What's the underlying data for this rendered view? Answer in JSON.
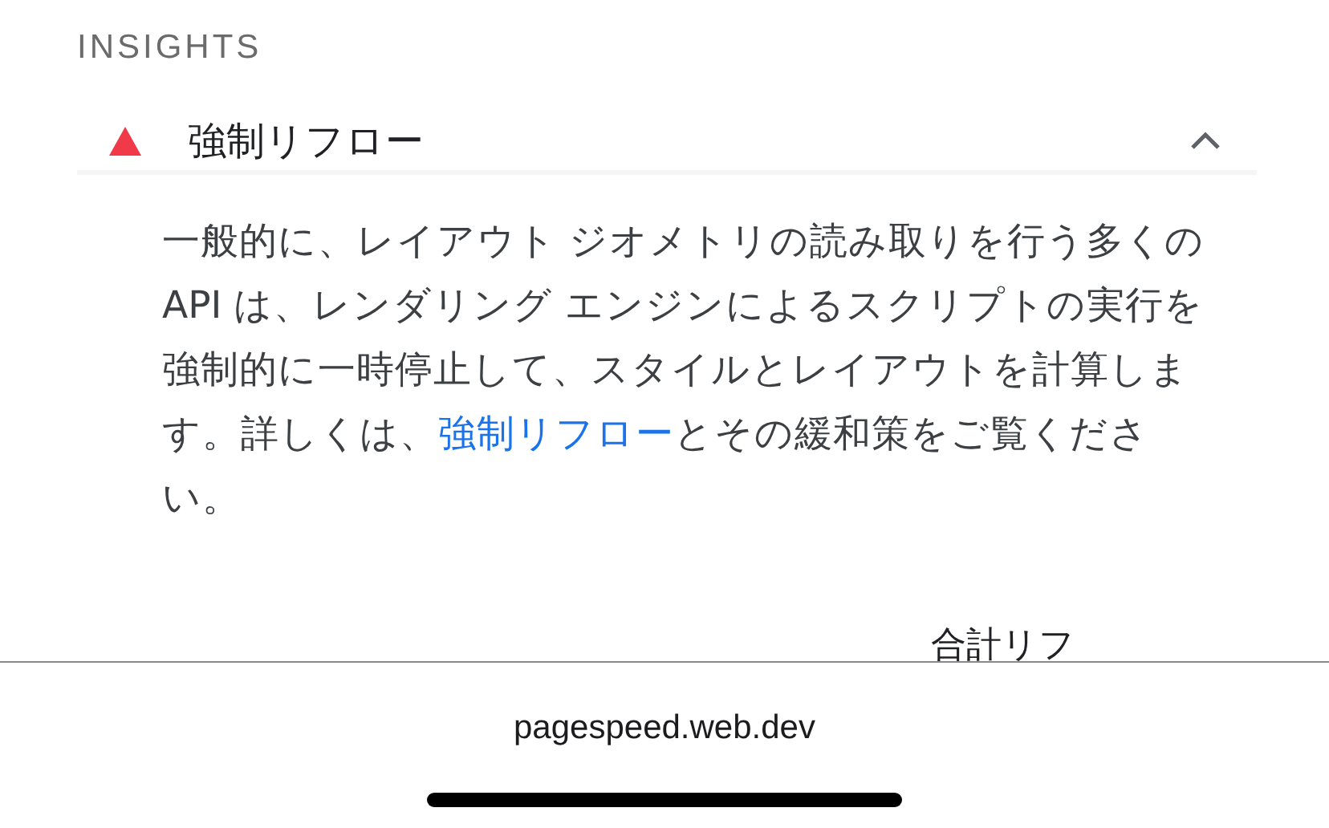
{
  "section_title": "INSIGHTS",
  "insight": {
    "title": "強制リフロー",
    "failed": true,
    "expanded": true,
    "description": {
      "before": "一般的に、レイアウト ジオメトリの読み取りを行う多くの API は、レンダリング エンジンによるスクリプトの実行を強制的に一時停止して、スタイルとレイアウトを計算します。詳しくは、",
      "link": "強制リフロー",
      "after": "とその緩和策をご覧ください。"
    },
    "cut_text": "合計リフ"
  },
  "address_bar": {
    "url": "pagespeed.web.dev"
  }
}
